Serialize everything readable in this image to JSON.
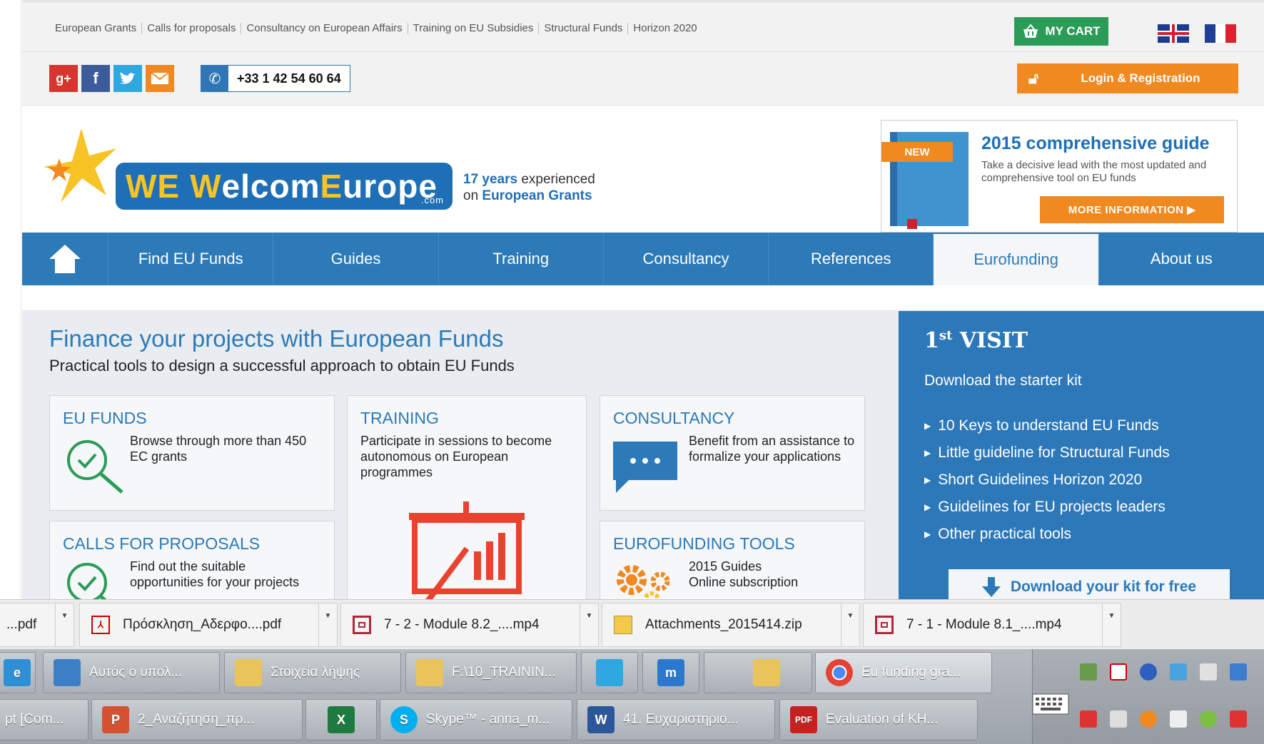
{
  "top_links": [
    "European Grants",
    "Calls for proposals",
    "Consultancy on European Affairs",
    "Training on EU Subsidies",
    "Structural Funds",
    "Horizon 2020"
  ],
  "cart_label": "MY CART",
  "phone": "+33 1 42 54 60 64",
  "login_label": "Login & Registration",
  "logo": {
    "we": "WE",
    "w": "W",
    "elcom": "elcom",
    "e": "E",
    "urope": "urope",
    "com": ".com"
  },
  "tagline": {
    "line1_bold": "17 years",
    "line1_rest": " experienced",
    "line2_pre": "on ",
    "line2_bold": "European Grants"
  },
  "guide": {
    "new_tag": "NEW",
    "title": "2015 comprehensive guide",
    "desc": "Take a decisive lead with the most updated and comprehensive tool on EU funds",
    "button": "MORE INFORMATION ▶"
  },
  "nav": {
    "items": [
      "Find EU Funds",
      "Guides",
      "Training",
      "Consultancy",
      "References",
      "Eurofunding",
      "About us"
    ],
    "active": "Eurofunding"
  },
  "main": {
    "title": "Finance your projects with European Funds",
    "subtitle": "Practical tools to design a successful approach to obtain EU Funds",
    "cards": {
      "eu_funds": {
        "title": "EU FUNDS",
        "text": "Browse through more than 450 EC grants"
      },
      "training": {
        "title": "TRAINING",
        "text": "Participate in sessions to become autonomous on European programmes"
      },
      "consultancy": {
        "title": "CONSULTANCY",
        "text": "Benefit from an assistance to formalize your applications"
      },
      "calls": {
        "title": "CALLS FOR PROPOSALS",
        "text": "Find out the suitable opportunities for your projects"
      },
      "tools": {
        "title": "EUROFUNDING TOOLS",
        "line1": "2015 Guides",
        "line2": "Online subscription"
      }
    }
  },
  "visit": {
    "title_num": "1",
    "title_sup": "st",
    "title_rest": " VISIT",
    "subtitle": "Download the starter kit",
    "items": [
      "10 Keys to understand EU Funds",
      "Little guideline for Structural Funds",
      "Short Guidelines Horizon 2020",
      "Guidelines for EU projects leaders",
      "Other practical tools"
    ],
    "download_label": "Download your kit for free"
  },
  "downloads": [
    {
      "name": "...pdf",
      "type": "pdf"
    },
    {
      "name": "Πρόσκληση_Αδερφο....pdf",
      "type": "pdf"
    },
    {
      "name": "7 - 2 - Module 8.2_....mp4",
      "type": "video"
    },
    {
      "name": "Attachments_2015414.zip",
      "type": "zip"
    },
    {
      "name": "7 - 1 - Module 8.1_....mp4",
      "type": "video"
    }
  ],
  "taskbar": {
    "row1": [
      "Αυτός ο υπολ...",
      "Στοιχεία λήψης",
      "F:\\10_TRAININ...",
      "",
      "",
      "",
      "Eu funding gra..."
    ],
    "row2": [
      "pt [Com...",
      "2_Αναζήτηση_πρ...",
      "",
      "Skype™ - anna_m...",
      "41. Ευχαριστηριο...",
      "Evaluation of KH..."
    ]
  },
  "colors": {
    "brand_blue": "#2c7ab8",
    "orange": "#f0891f",
    "green": "#2a9c57",
    "logo_yellow": "#f7c325"
  }
}
